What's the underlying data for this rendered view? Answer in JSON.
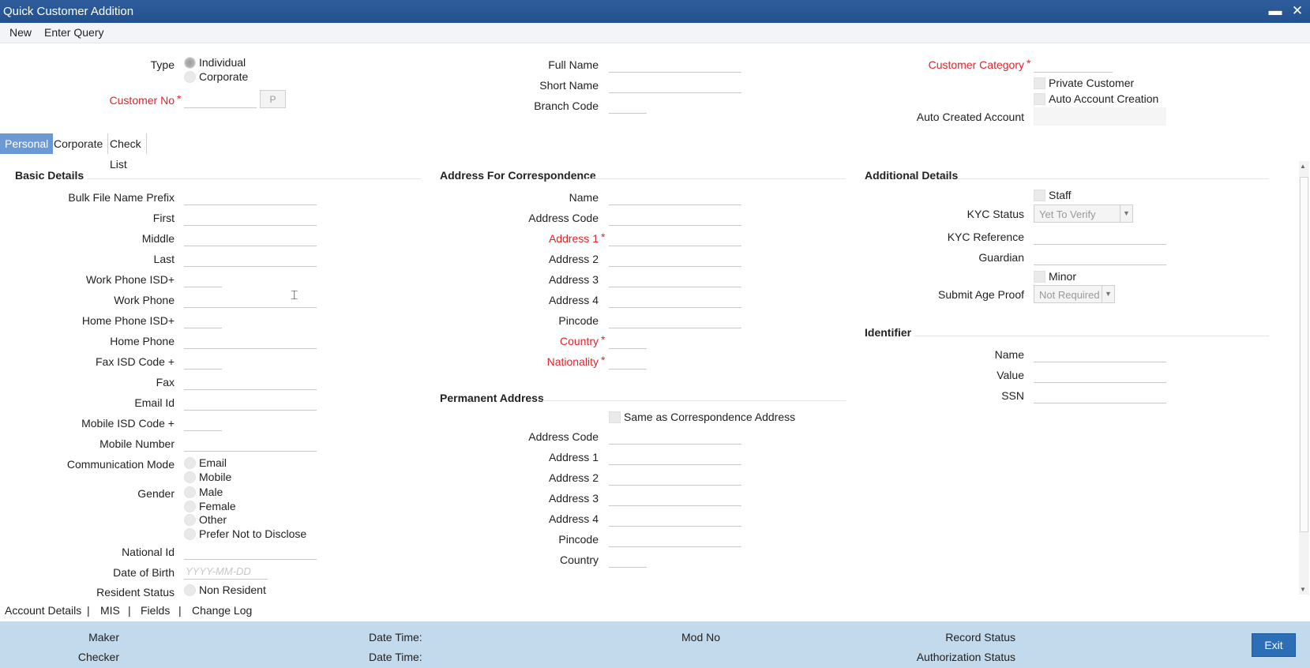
{
  "window": {
    "title": "Quick Customer Addition",
    "minimize": "▬",
    "close": "✕"
  },
  "menu": {
    "new": "New",
    "enter_query": "Enter Query"
  },
  "header": {
    "type_label": "Type",
    "type_individual": "Individual",
    "type_corporate": "Corporate",
    "customer_no_label": "Customer No",
    "p_button": "P",
    "full_name_label": "Full Name",
    "short_name_label": "Short Name",
    "branch_code_label": "Branch Code",
    "customer_category_label": "Customer Category",
    "private_customer": "Private Customer",
    "auto_account_creation": "Auto Account Creation",
    "auto_created_account_label": "Auto Created Account",
    "required_mark": "*"
  },
  "tabs": [
    {
      "label": "Personal",
      "active": true
    },
    {
      "label": "Corporate",
      "active": false
    },
    {
      "label": "Check List",
      "active": false
    }
  ],
  "basic": {
    "section": "Basic Details",
    "bulk_file": "Bulk File Name Prefix",
    "first": "First",
    "middle": "Middle",
    "last": "Last",
    "work_phone_isd": "Work Phone ISD+",
    "work_phone": "Work Phone",
    "home_phone_isd": "Home Phone ISD+",
    "home_phone": "Home Phone",
    "fax_isd": "Fax ISD Code +",
    "fax": "Fax",
    "email_id": "Email Id",
    "mobile_isd": "Mobile ISD Code +",
    "mobile_number": "Mobile Number",
    "comm_mode": "Communication Mode",
    "comm_email": "Email",
    "comm_mobile": "Mobile",
    "gender": "Gender",
    "gender_male": "Male",
    "gender_female": "Female",
    "gender_other": "Other",
    "gender_prefer": "Prefer Not to Disclose",
    "national_id": "National Id",
    "dob": "Date of Birth",
    "dob_placeholder": "YYYY-MM-DD",
    "resident_status": "Resident Status",
    "non_resident": "Non Resident"
  },
  "correspondence": {
    "section": "Address For Correspondence",
    "name": "Name",
    "address_code": "Address Code",
    "address1": "Address 1",
    "address2": "Address 2",
    "address3": "Address 3",
    "address4": "Address 4",
    "pincode": "Pincode",
    "country": "Country",
    "nationality": "Nationality"
  },
  "permanent": {
    "section": "Permanent Address",
    "same_as": "Same as Correspondence Address",
    "address_code": "Address Code",
    "address1": "Address 1",
    "address2": "Address 2",
    "address3": "Address 3",
    "address4": "Address 4",
    "pincode": "Pincode",
    "country": "Country"
  },
  "additional": {
    "section": "Additional Details",
    "staff": "Staff",
    "kyc_status": "KYC Status",
    "kyc_status_value": "Yet To Verify",
    "kyc_reference": "KYC Reference",
    "guardian": "Guardian",
    "minor": "Minor",
    "submit_age_proof": "Submit Age Proof",
    "submit_age_proof_value": "Not Required"
  },
  "identifier": {
    "section": "Identifier",
    "name": "Name",
    "value": "Value",
    "ssn": "SSN"
  },
  "links": {
    "account_details": "Account Details",
    "mis": "MIS",
    "fields": "Fields",
    "change_log": "Change Log",
    "sep": "|"
  },
  "footer": {
    "maker": "Maker",
    "checker": "Checker",
    "date_time": "Date Time:",
    "mod_no": "Mod No",
    "record_status": "Record Status",
    "authorization_status": "Authorization Status",
    "exit": "Exit"
  }
}
